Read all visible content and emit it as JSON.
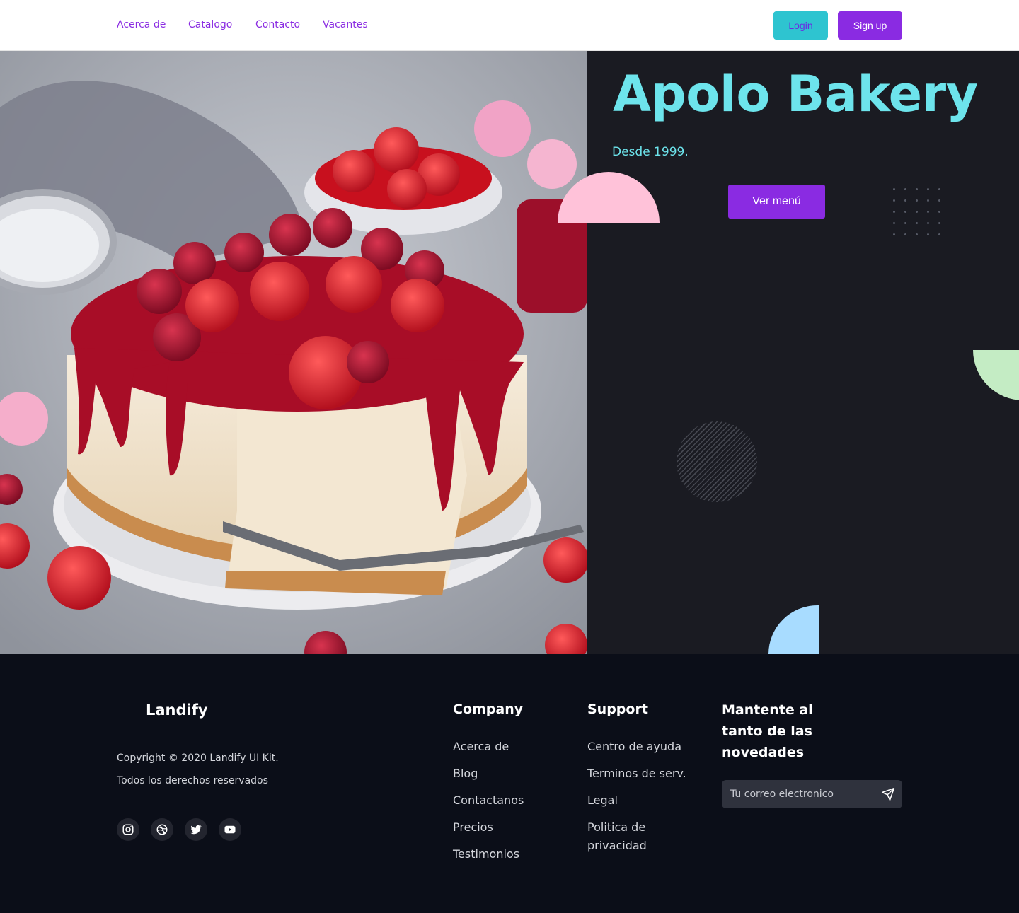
{
  "nav": {
    "links": [
      "Acerca de",
      "Catalogo",
      "Contacto",
      "Vacantes"
    ],
    "login_label": "Login",
    "signup_label": "Sign up"
  },
  "hero": {
    "title": "Apolo Bakery",
    "subtitle": "Desde 1999.",
    "menu_button": "Ver menú",
    "image_icon": "cheesecake-photo"
  },
  "footer": {
    "brand": "Landify",
    "copyright": "Copyright © 2020 Landify UI Kit.",
    "rights": "Todos los derechos reservados",
    "social": [
      "instagram-icon",
      "dribbble-icon",
      "twitter-icon",
      "youtube-icon"
    ],
    "company": {
      "title": "Company",
      "links": [
        "Acerca de",
        "Blog",
        "Contactanos",
        "Precios",
        "Testimonios"
      ]
    },
    "support": {
      "title": "Support",
      "links": [
        "Centro de ayuda",
        "Terminos de serv.",
        "Legal",
        "Politica de privacidad"
      ]
    },
    "newsletter": {
      "title": "Mantente al tanto de las novedades",
      "placeholder": "Tu correo electronico"
    }
  },
  "colors": {
    "accent": "#8a2be2",
    "cyan": "#6de4ec",
    "login": "#2ec4d0",
    "panel": "#1a1b22",
    "footer": "#0b0e18"
  }
}
